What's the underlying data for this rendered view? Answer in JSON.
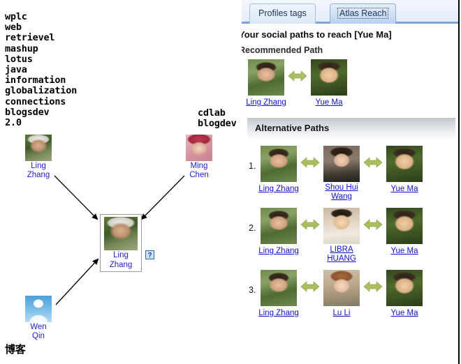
{
  "graph": {
    "tag_clouds": [
      {
        "id": "tags-left",
        "text": "wplc\nweb\nretrievel\nmashup\nlotus\njava\ninformation\nglobalization\nconnections\nblogsdev\n2.0"
      },
      {
        "id": "tags-right",
        "text": "cdlab\nblogdev"
      },
      {
        "id": "tags-bottom",
        "text": "博客"
      }
    ],
    "nodes": {
      "top_left": {
        "name": "Ling Zhang",
        "photo": "ph-ling"
      },
      "top_right": {
        "name": "Ming Chen",
        "photo": "ph-baby"
      },
      "bottom_left": {
        "name": "Wen Qin",
        "photo": "ph-default"
      },
      "center": {
        "name": "Ling Zhang",
        "photo": "ph-ling"
      }
    },
    "help_icon_label": "?"
  },
  "reach": {
    "tabs": [
      {
        "id": "profiles",
        "label": "Profiles tags",
        "active": false
      },
      {
        "id": "atlas",
        "label": "Atlas Reach",
        "active": true
      }
    ],
    "title": "Your social paths to reach [Yue Ma]",
    "recommended_heading": "Recommended Path",
    "recommended_path": {
      "people": [
        {
          "name": "Ling Zhang",
          "photo": "ph-ling2"
        },
        {
          "name": "Yue Ma",
          "photo": "ph-yue"
        }
      ]
    },
    "alternative_heading": "Alternative Paths",
    "alternative_paths": [
      {
        "index": "1.",
        "people": [
          {
            "name": "Ling Zhang",
            "photo": "ph-ling2"
          },
          {
            "name": "Shou Hui Wang",
            "photo": "ph-shouhui"
          },
          {
            "name": "Yue Ma",
            "photo": "ph-yue"
          }
        ]
      },
      {
        "index": "2.",
        "people": [
          {
            "name": "Ling Zhang",
            "photo": "ph-ling2"
          },
          {
            "name": "LIBRA HUANG",
            "photo": "ph-libra"
          },
          {
            "name": "Yue Ma",
            "photo": "ph-yue"
          }
        ]
      },
      {
        "index": "3.",
        "people": [
          {
            "name": "Ling Zhang",
            "photo": "ph-ling2"
          },
          {
            "name": "Lu Li",
            "photo": "ph-luli"
          },
          {
            "name": "Yue Ma",
            "photo": "ph-yue"
          }
        ]
      }
    ],
    "arrow_icon": "double-arrow-icon",
    "colors": {
      "arrow": "#a8bf5e",
      "link": "#1111cc",
      "tab_active": "#b9d2ee",
      "tab_strip_rule": "#7fa2d4"
    }
  }
}
